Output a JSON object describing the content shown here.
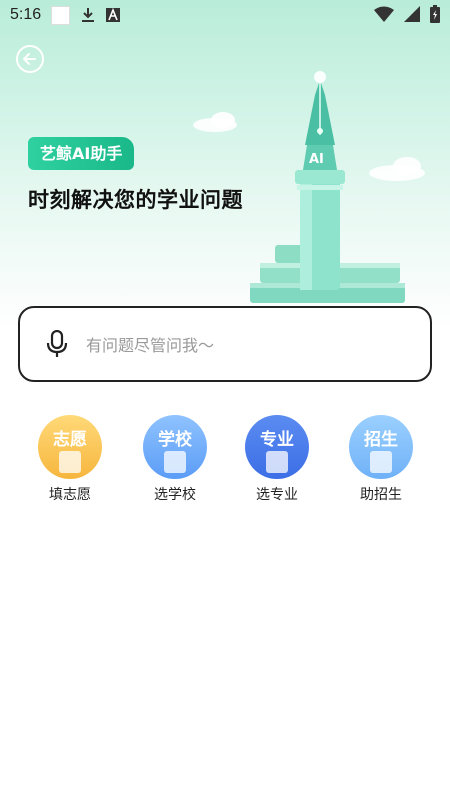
{
  "status_bar": {
    "time": "5:16"
  },
  "header": {
    "back_icon": "back-arrow-icon"
  },
  "hero": {
    "badge": "艺鲸AI助手",
    "headline": "时刻解决您的学业问题",
    "pen_text": "AI"
  },
  "search": {
    "placeholder": "有问题尽管问我～",
    "mic_icon": "microphone-icon"
  },
  "features": [
    {
      "tag": "志愿",
      "label": "填志愿",
      "color_top": "#ffd978",
      "color_bottom": "#f6b63e"
    },
    {
      "tag": "学校",
      "label": "选学校",
      "color_top": "#8fc3ff",
      "color_bottom": "#5b9cf6"
    },
    {
      "tag": "专业",
      "label": "选专业",
      "color_top": "#5b8cf1",
      "color_bottom": "#3c6ee6"
    },
    {
      "tag": "招生",
      "label": "助招生",
      "color_top": "#9bd0ff",
      "color_bottom": "#6fb1f7"
    }
  ]
}
